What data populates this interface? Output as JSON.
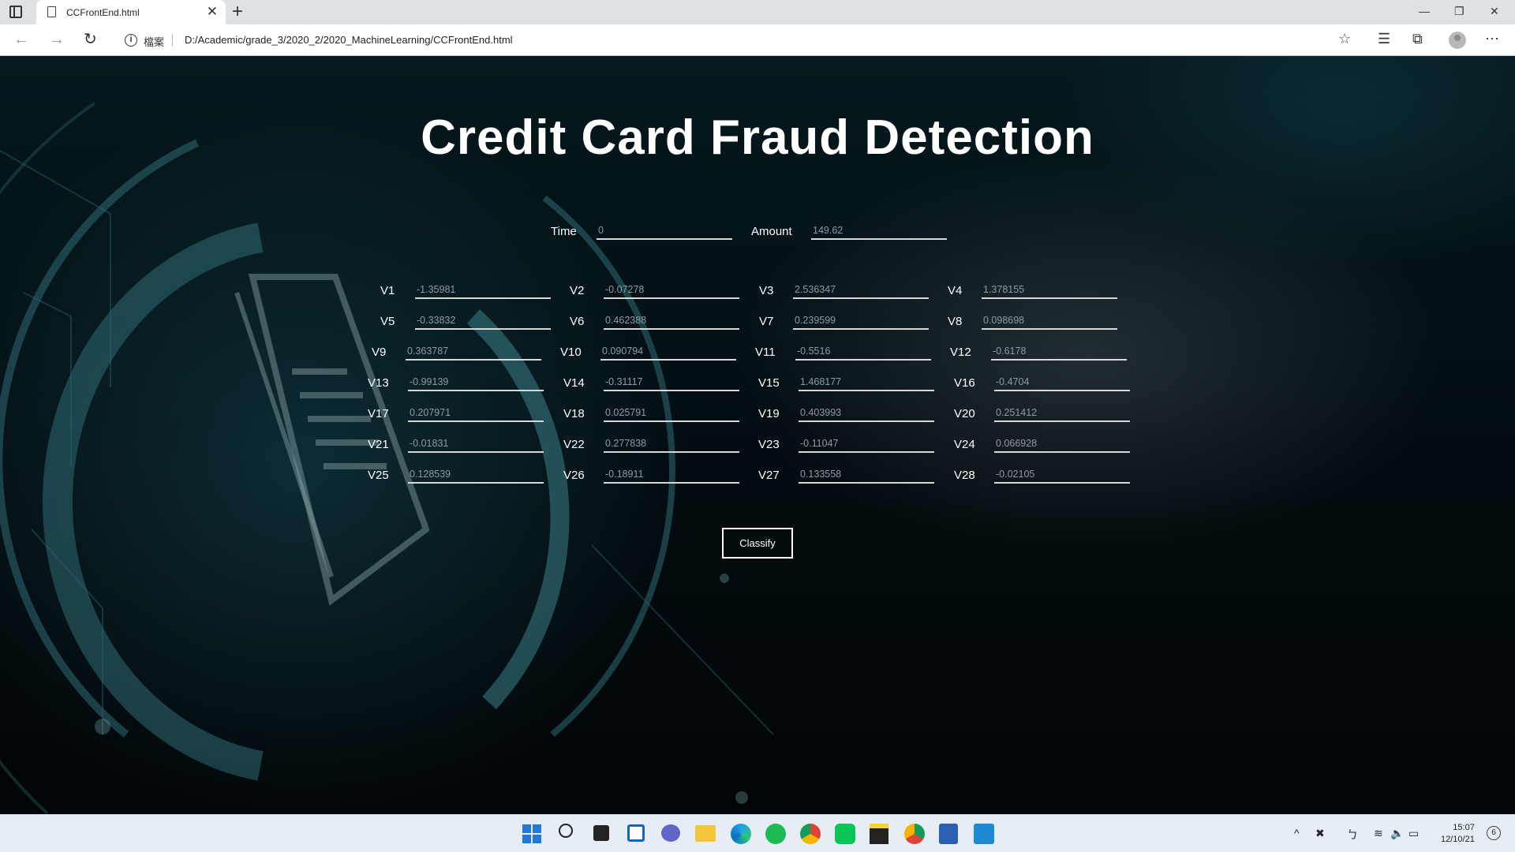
{
  "browser": {
    "tab_title": "CCFrontEnd.html",
    "close_glyph": "✕",
    "new_tab_glyph": "+",
    "window_controls": {
      "minimize": "—",
      "restore": "❐",
      "close": "✕"
    },
    "nav": {
      "back": "←",
      "forward": "→",
      "reload": "↻"
    },
    "address": {
      "info_glyph": "i",
      "security_label": "檔案",
      "url": "D:/Academic/grade_3/2020_2/2020_MachineLearning/CCFrontEnd.html"
    },
    "toolbar_icons": [
      "add-favorite-icon",
      "favorites-icon",
      "collections-icon",
      "profile-icon",
      "more-icon"
    ],
    "toolbar_glyphs": {
      "favorite": "☆",
      "favorites": "☰",
      "collections": "⧉",
      "more": "⋯"
    }
  },
  "page": {
    "title": "Credit Card Fraud Detection",
    "top_fields": [
      {
        "label": "Time",
        "value": "0"
      },
      {
        "label": "Amount",
        "value": "149.62"
      }
    ],
    "fields": [
      {
        "label": "V1",
        "value": "-1.35981"
      },
      {
        "label": "V2",
        "value": "-0.07278"
      },
      {
        "label": "V3",
        "value": "2.536347"
      },
      {
        "label": "V4",
        "value": "1.378155"
      },
      {
        "label": "V5",
        "value": "-0.33832"
      },
      {
        "label": "V6",
        "value": "0.462388"
      },
      {
        "label": "V7",
        "value": "0.239599"
      },
      {
        "label": "V8",
        "value": "0.098698"
      },
      {
        "label": "V9",
        "value": "0.363787"
      },
      {
        "label": "V10",
        "value": "0.090794"
      },
      {
        "label": "V11",
        "value": "-0.5516"
      },
      {
        "label": "V12",
        "value": "-0.6178"
      },
      {
        "label": "V13",
        "value": "-0.99139"
      },
      {
        "label": "V14",
        "value": "-0.31117"
      },
      {
        "label": "V15",
        "value": "1.468177"
      },
      {
        "label": "V16",
        "value": "-0.4704"
      },
      {
        "label": "V17",
        "value": "0.207971"
      },
      {
        "label": "V18",
        "value": "0.025791"
      },
      {
        "label": "V19",
        "value": "0.403993"
      },
      {
        "label": "V20",
        "value": "0.251412"
      },
      {
        "label": "V21",
        "value": "-0.01831"
      },
      {
        "label": "V22",
        "value": "0.277838"
      },
      {
        "label": "V23",
        "value": "-0.11047"
      },
      {
        "label": "V24",
        "value": "0.066928"
      },
      {
        "label": "V25",
        "value": "0.128539"
      },
      {
        "label": "V26",
        "value": "-0.18911"
      },
      {
        "label": "V27",
        "value": "0.133558"
      },
      {
        "label": "V28",
        "value": "-0.02105"
      }
    ],
    "classify_label": "Classify"
  },
  "taskbar": {
    "apps": [
      "start-icon",
      "search-icon",
      "task-view-icon",
      "widgets-icon",
      "chat-icon",
      "file-explorer-icon",
      "edge-icon",
      "spotify-icon",
      "chrome-icon",
      "line-icon",
      "sticky-notes-icon",
      "chrome-profile-icon",
      "word-icon",
      "vscode-icon"
    ],
    "tray": {
      "chevron": "^",
      "circle_x": "✖",
      "ime": "ㄅ",
      "wifi": "≋",
      "volume": "🔈",
      "battery": "▭"
    },
    "time": "15:07",
    "date": "12/10/21",
    "notification_count": "6"
  }
}
